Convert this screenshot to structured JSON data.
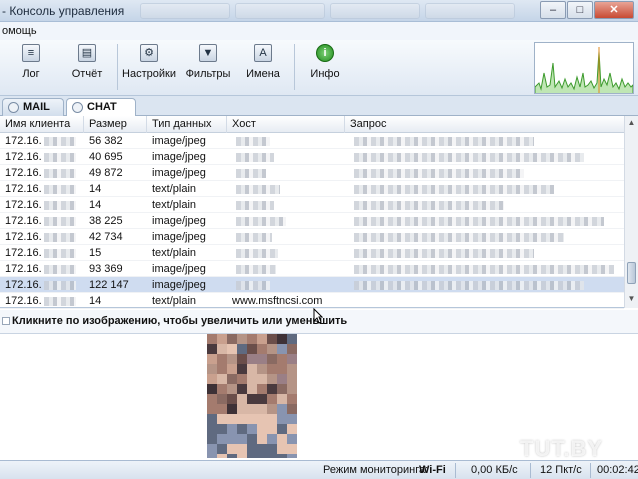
{
  "window": {
    "title": "- Консоль управления"
  },
  "menu": {
    "items": [
      "омощь"
    ]
  },
  "toolbar": {
    "buttons": [
      {
        "label": "Лог",
        "icon": "log-icon"
      },
      {
        "label": "Отчёт",
        "icon": "report-icon"
      },
      {
        "label": "Настройки",
        "icon": "settings-icon"
      },
      {
        "label": "Фильтры",
        "icon": "filter-icon"
      },
      {
        "label": "Имена",
        "icon": "names-icon"
      },
      {
        "label": "Инфо",
        "icon": "info-icon"
      }
    ]
  },
  "tabs": [
    {
      "label": "MAIL",
      "active": false
    },
    {
      "label": "CHAT",
      "active": true
    }
  ],
  "table": {
    "columns": [
      "Имя клиента",
      "Размер",
      "Тип данных",
      "Хост",
      "Запрос"
    ],
    "rows": [
      {
        "client": "172.16.",
        "size": "56 382",
        "type": "image/jpeg",
        "host": "",
        "selected": false
      },
      {
        "client": "172.16.",
        "size": "40 695",
        "type": "image/jpeg",
        "host": "",
        "selected": false
      },
      {
        "client": "172.16.",
        "size": "49 872",
        "type": "image/jpeg",
        "host": "",
        "selected": false
      },
      {
        "client": "172.16.",
        "size": "14",
        "type": "text/plain",
        "host": "",
        "selected": false
      },
      {
        "client": "172.16.",
        "size": "14",
        "type": "text/plain",
        "host": "",
        "selected": false
      },
      {
        "client": "172.16.",
        "size": "38 225",
        "type": "image/jpeg",
        "host": "",
        "selected": false
      },
      {
        "client": "172.16.",
        "size": "42 734",
        "type": "image/jpeg",
        "host": "",
        "selected": false
      },
      {
        "client": "172.16.",
        "size": "15",
        "type": "text/plain",
        "host": "",
        "selected": false
      },
      {
        "client": "172.16.",
        "size": "93 369",
        "type": "image/jpeg",
        "host": "",
        "selected": false
      },
      {
        "client": "172.16.",
        "size": "122 147",
        "type": "image/jpeg",
        "host": "",
        "selected": true
      },
      {
        "client": "172.16.",
        "size": "14",
        "type": "text/plain",
        "host": "www.msftncsi.com",
        "selected": false
      }
    ]
  },
  "image_panel": {
    "hint": "Кликните по изображению, чтобы увеличить или уменьшить"
  },
  "status": {
    "monitor_label": "Режим мониторинга:",
    "monitor_value": "Wi-Fi",
    "speed": "0,00 КБ/с",
    "packets": "12 Пкт/с",
    "time": "00:02:42"
  },
  "watermark": "TUT.BY",
  "colors": {
    "selected_row": "#cfdcf0",
    "graph_line": "#3c9a2c",
    "graph_accent": "#e08a1e"
  }
}
